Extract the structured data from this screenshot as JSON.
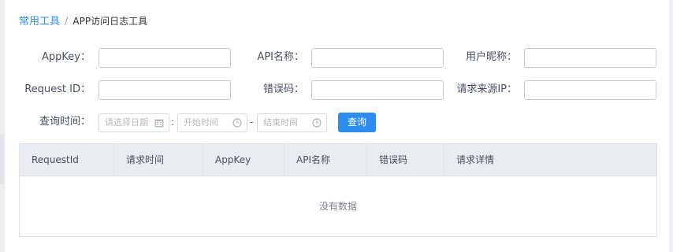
{
  "breadcrumb": {
    "root": "常用工具",
    "separator": "/",
    "current": "APP访问日志工具"
  },
  "filters": {
    "appkey_label": "AppKey：",
    "api_name_label": "API名称：",
    "user_nickname_label": "用户昵称：",
    "request_id_label": "Request ID：",
    "error_code_label": "错误码：",
    "source_ip_label": "请求来源IP：",
    "query_time_label": "查询时间：",
    "appkey_value": "",
    "api_name_value": "",
    "user_nickname_value": "",
    "request_id_value": "",
    "error_code_value": "",
    "source_ip_value": "",
    "date_placeholder": "请选择日期",
    "start_time_placeholder": "开始时间",
    "end_time_placeholder": "结束时间",
    "time_colon": ":",
    "range_dash": "-"
  },
  "actions": {
    "search_label": "查询"
  },
  "table": {
    "columns": [
      "RequestId",
      "请求时间",
      "AppKey",
      "API名称",
      "错误码",
      "请求详情"
    ],
    "empty_text": "没有数据"
  },
  "icons": {
    "date": "calendar-icon",
    "time": "clock-icon"
  },
  "colors": {
    "accent": "#2d8cf0",
    "header_bg": "#e8ebef"
  }
}
